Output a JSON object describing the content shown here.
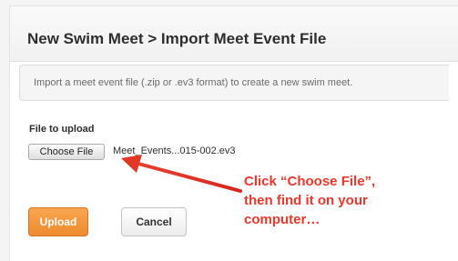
{
  "panel": {
    "title": "New Swim Meet > Import Meet Event File"
  },
  "info": {
    "text": "Import a meet event file (.zip or .ev3 format) to create a new swim meet."
  },
  "file_input": {
    "label": "File to upload",
    "button_label": "Choose File",
    "file_name": "Meet_Events...015-002.ev3"
  },
  "actions": {
    "upload_label": "Upload",
    "cancel_label": "Cancel"
  },
  "annotation": {
    "lines": [
      "Click “Choose File”,",
      "then find it on your",
      "computer…"
    ],
    "color": "#e8372b"
  },
  "colors": {
    "upload_accent": "#f0922f",
    "annotation_red": "#e8372b"
  }
}
